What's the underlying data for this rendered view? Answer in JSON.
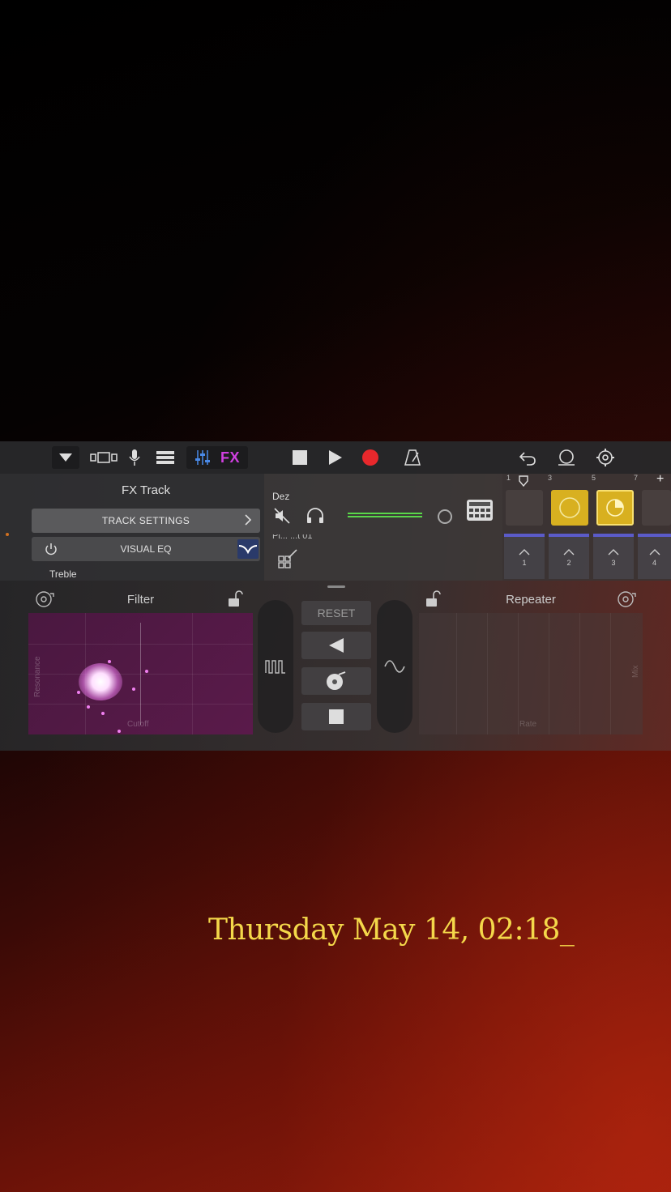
{
  "toolbar": {
    "fx_label": "FX",
    "icons": [
      "dropdown-triangle-icon",
      "tracks-view-icon",
      "microphone-icon",
      "list-view-icon",
      "mixer-icon",
      "stop-icon",
      "play-icon",
      "record-icon",
      "metronome-icon",
      "undo-icon",
      "loop-icon",
      "settings-icon"
    ],
    "accent_record": "#e8282c",
    "accent_fx": "#d040e0"
  },
  "left_panel": {
    "title": "FX Track",
    "track_settings_label": "TRACK SETTINGS",
    "visual_eq_label": "VISUAL EQ",
    "treble_label": "Treble"
  },
  "track": {
    "name": "Dez",
    "sub_label": "Pi... ...t 01"
  },
  "grid": {
    "ruler": [
      "1",
      "3",
      "5",
      "7"
    ],
    "add_label": "+",
    "triggers": [
      "1",
      "2",
      "3",
      "4"
    ]
  },
  "filter": {
    "title": "Filter",
    "y_axis": "Resonance",
    "x_axis": "Cutoff"
  },
  "center": {
    "reset_label": "RESET"
  },
  "repeater": {
    "title": "Repeater",
    "x_axis": "Rate",
    "y_axis": "Mix"
  },
  "overlay": {
    "date_text": "Thursday May 14, 02:18_"
  }
}
